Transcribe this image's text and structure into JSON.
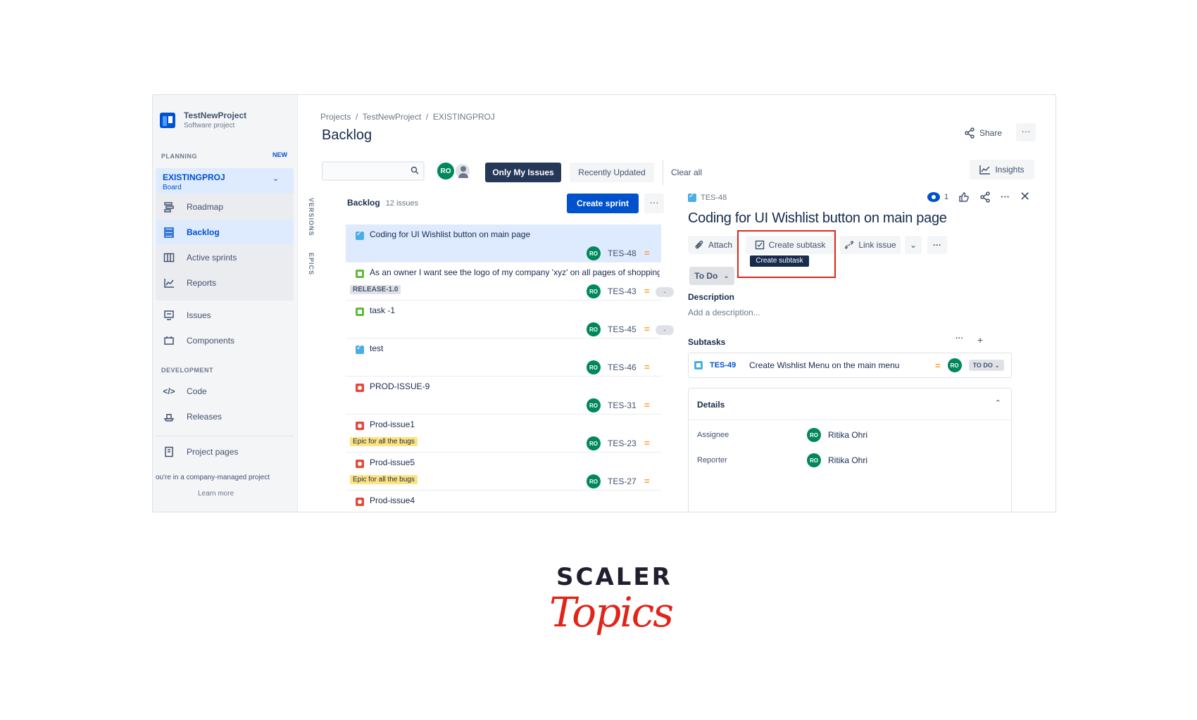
{
  "sidebar": {
    "project_name": "TestNewProject",
    "project_type": "Software project",
    "planning_label": "PLANNING",
    "new_badge": "NEW",
    "board_name": "EXISTINGPROJ",
    "board_sub": "Board",
    "items": [
      {
        "label": "Roadmap",
        "icon": "roadmap-icon"
      },
      {
        "label": "Backlog",
        "icon": "backlog-icon",
        "active": true
      },
      {
        "label": "Active sprints",
        "icon": "board-icon"
      },
      {
        "label": "Reports",
        "icon": "chart-icon"
      },
      {
        "label": "Issues",
        "icon": "issues-icon"
      },
      {
        "label": "Components",
        "icon": "components-icon"
      }
    ],
    "development_label": "DEVELOPMENT",
    "dev_items": [
      {
        "label": "Code",
        "icon": "code-icon"
      },
      {
        "label": "Releases",
        "icon": "ship-icon"
      }
    ],
    "project_pages": "Project pages",
    "managed_note": "ou're in a company-managed project",
    "learn_more": "Learn more"
  },
  "header": {
    "breadcrumb": "Projects  /  TestNewProject  /  EXISTINGPROJ",
    "title": "Backlog",
    "share": "Share",
    "more": "···",
    "insights": "Insights"
  },
  "filters": {
    "search_placeholder": "",
    "avatar_initials": "RO",
    "only_my_issues": "Only My Issues",
    "recently_updated": "Recently Updated",
    "clear_all": "Clear all"
  },
  "side_tabs": {
    "versions": "VERSIONS",
    "epics": "EPICS"
  },
  "backlog": {
    "title": "Backlog",
    "count": "12 issues",
    "create_sprint": "Create sprint",
    "more": "···",
    "issues": [
      {
        "type": "task",
        "summary": "Coding for UI Wishlist button on main page",
        "key": "TES-48",
        "lozenge": "",
        "est": "",
        "selected": true
      },
      {
        "type": "story",
        "summary": "As an owner I want see the logo of my company 'xyz' on all pages of shopping",
        "key": "TES-43",
        "lozenge": "RELEASE-1.0",
        "est": "-"
      },
      {
        "type": "story",
        "summary": "task -1",
        "key": "TES-45",
        "lozenge": "",
        "est": "-"
      },
      {
        "type": "task",
        "summary": "test",
        "key": "TES-46",
        "lozenge": "",
        "est": ""
      },
      {
        "type": "bug",
        "summary": "PROD-ISSUE-9",
        "key": "TES-31",
        "lozenge": "",
        "est": ""
      },
      {
        "type": "bug",
        "summary": "Prod-issue1",
        "key": "TES-23",
        "lozenge": "Epic for all the bugs",
        "est": ""
      },
      {
        "type": "bug",
        "summary": "Prod-issue5",
        "key": "TES-27",
        "lozenge": "Epic for all the bugs",
        "est": ""
      },
      {
        "type": "bug",
        "summary": "Prod-issue4",
        "key": "",
        "lozenge": "",
        "est": ""
      }
    ]
  },
  "detail": {
    "key": "TES-48",
    "watchers": "1",
    "title": "Coding for UI Wishlist button on main page",
    "attach": "Attach",
    "create_subtask": "Create subtask",
    "tooltip": "Create subtask",
    "link_issue": "Link issue",
    "status": "To Do",
    "description_label": "Description",
    "description_placeholder": "Add a description...",
    "subtasks_label": "Subtasks",
    "subtask": {
      "key": "TES-49",
      "summary": "Create Wishlist Menu on the main menu",
      "status": "TO DO"
    },
    "details_label": "Details",
    "assignee_label": "Assignee",
    "assignee": "Ritika Ohri",
    "reporter_label": "Reporter",
    "reporter": "Ritika Ohri"
  },
  "brand": {
    "top": "SCALER",
    "bottom": "Topics"
  },
  "colors": {
    "primary": "#0052cc",
    "avatar": "#00875a",
    "highlight": "#e0251b",
    "priority": "#ff991f"
  }
}
